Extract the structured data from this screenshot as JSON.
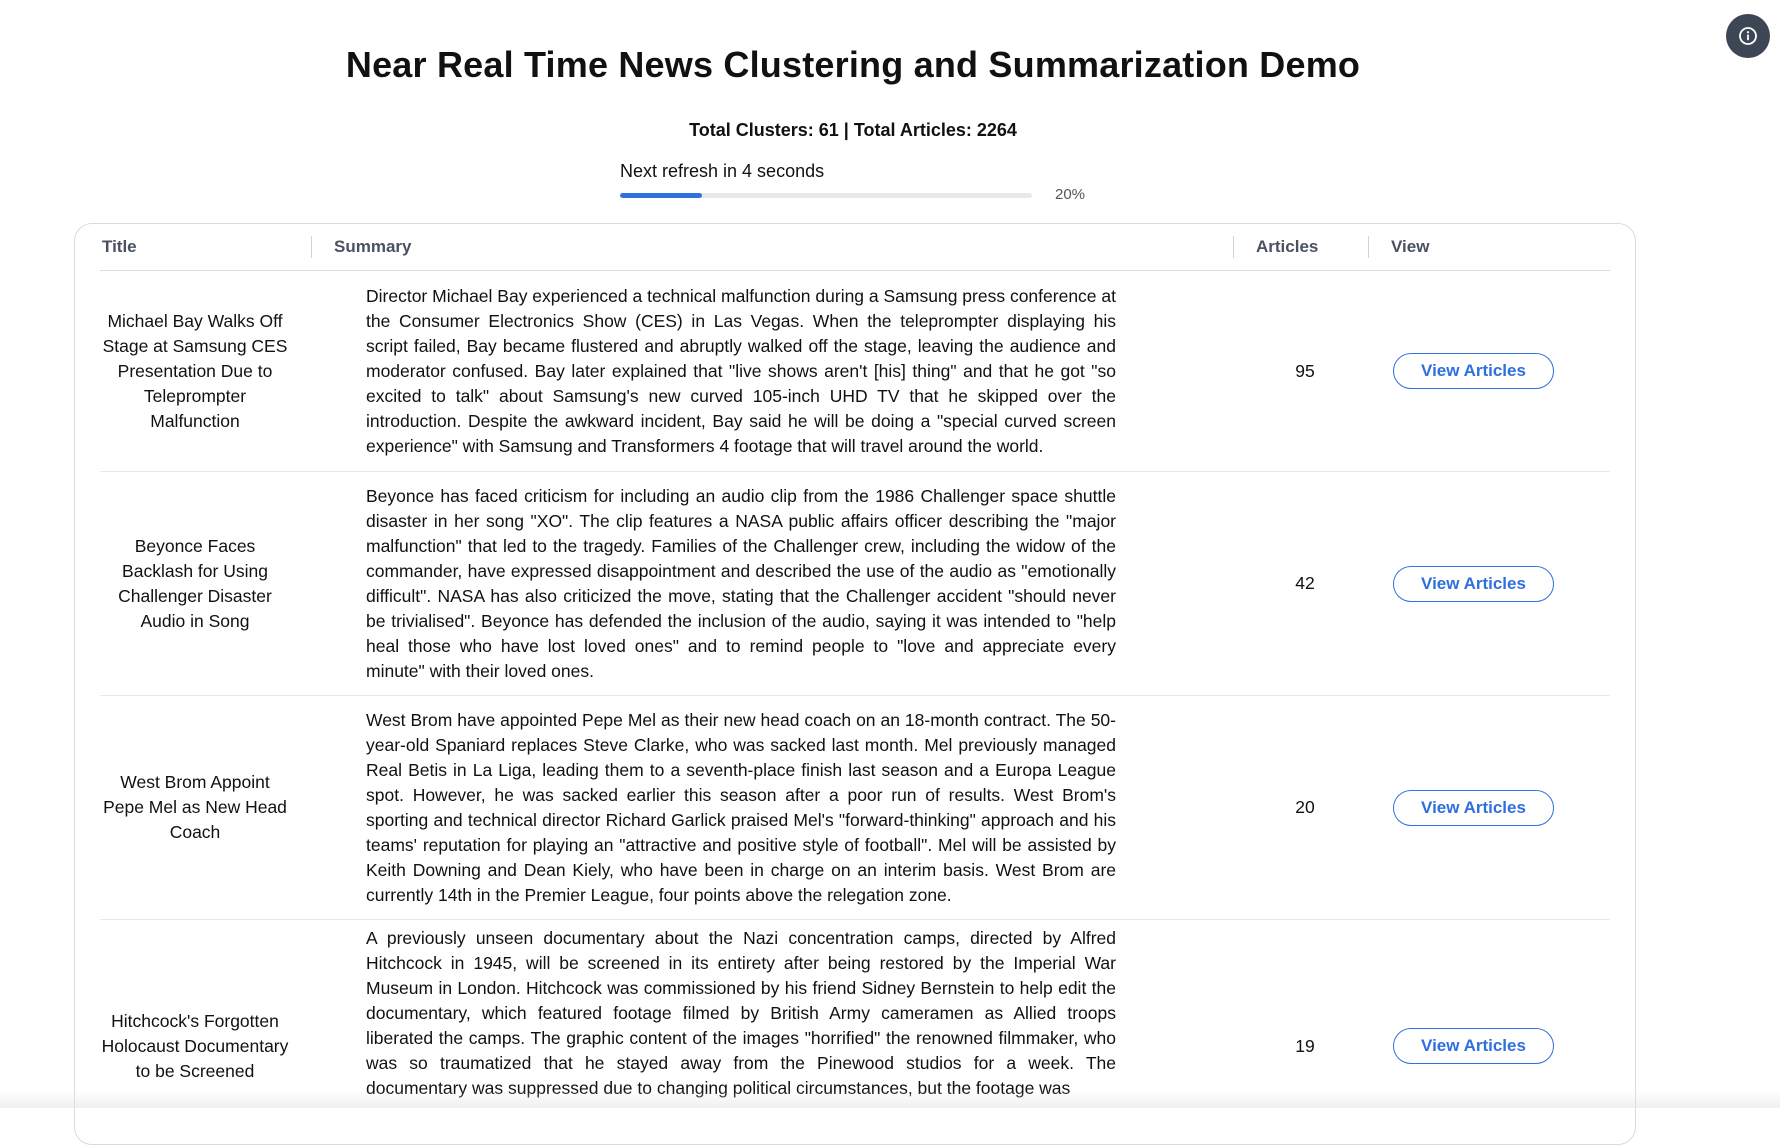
{
  "header": {
    "title": "Near Real Time News Clustering and Summarization Demo",
    "stats": "Total Clusters: 61 | Total Articles: 2264",
    "refresh_label": "Next refresh in 4 seconds",
    "refresh_progress_fraction": 0.2,
    "refresh_progress_text": "20%",
    "info_icon": "info-icon"
  },
  "colors": {
    "accent": "#2f6fde",
    "info_button_bg": "#3d4654"
  },
  "table": {
    "columns": [
      "Title",
      "Summary",
      "Articles",
      "View"
    ],
    "rows": [
      {
        "title": "Michael Bay Walks Off Stage at Samsung CES Presentation Due to Teleprompter Malfunction",
        "summary": "Director Michael Bay experienced a technical malfunction during a Samsung press conference at the Consumer Electronics Show (CES) in Las Vegas. When the teleprompter displaying his script failed, Bay became flustered and abruptly walked off the stage, leaving the audience and moderator confused. Bay later explained that \"live shows aren't [his] thing\" and that he got \"so excited to talk\" about Samsung's new curved 105-inch UHD TV that he skipped over the introduction. Despite the awkward incident, Bay said he will be doing a \"special curved screen experience\" with Samsung and Transformers 4 footage that will travel around the world.",
        "articles": "95",
        "button": "View Articles"
      },
      {
        "title": "Beyonce Faces Backlash for Using Challenger Disaster Audio in Song",
        "summary": "Beyonce has faced criticism for including an audio clip from the 1986 Challenger space shuttle disaster in her song \"XO\". The clip features a NASA public affairs officer describing the \"major malfunction\" that led to the tragedy. Families of the Challenger crew, including the widow of the commander, have expressed disappointment and described the use of the audio as \"emotionally difficult\". NASA has also criticized the move, stating that the Challenger accident \"should never be trivialised\". Beyonce has defended the inclusion of the audio, saying it was intended to \"help heal those who have lost loved ones\" and to remind people to \"love and appreciate every minute\" with their loved ones.",
        "articles": "42",
        "button": "View Articles"
      },
      {
        "title": "West Brom Appoint Pepe Mel as New Head Coach",
        "summary": "West Brom have appointed Pepe Mel as their new head coach on an 18-month contract. The 50-year-old Spaniard replaces Steve Clarke, who was sacked last month. Mel previously managed Real Betis in La Liga, leading them to a seventh-place finish last season and a Europa League spot. However, he was sacked earlier this season after a poor run of results. West Brom's sporting and technical director Richard Garlick praised Mel's \"forward-thinking\" approach and his teams' reputation for playing an \"attractive and positive style of football\". Mel will be assisted by Keith Downing and Dean Kiely, who have been in charge on an interim basis. West Brom are currently 14th in the Premier League, four points above the relegation zone.",
        "articles": "20",
        "button": "View Articles"
      },
      {
        "title": "Hitchcock's Forgotten Holocaust Documentary to be Screened",
        "summary": "A previously unseen documentary about the Nazi concentration camps, directed by Alfred Hitchcock in 1945, will be screened in its entirety after being restored by the Imperial War Museum in London. Hitchcock was commissioned by his friend Sidney Bernstein to help edit the documentary, which featured footage filmed by British Army cameramen as Allied troops liberated the camps. The graphic content of the images \"horrified\" the renowned filmmaker, who was so traumatized that he stayed away from the Pinewood studios for a week. The documentary was suppressed due to changing political circumstances, but the footage was",
        "articles": "19",
        "button": "View Articles"
      }
    ]
  }
}
